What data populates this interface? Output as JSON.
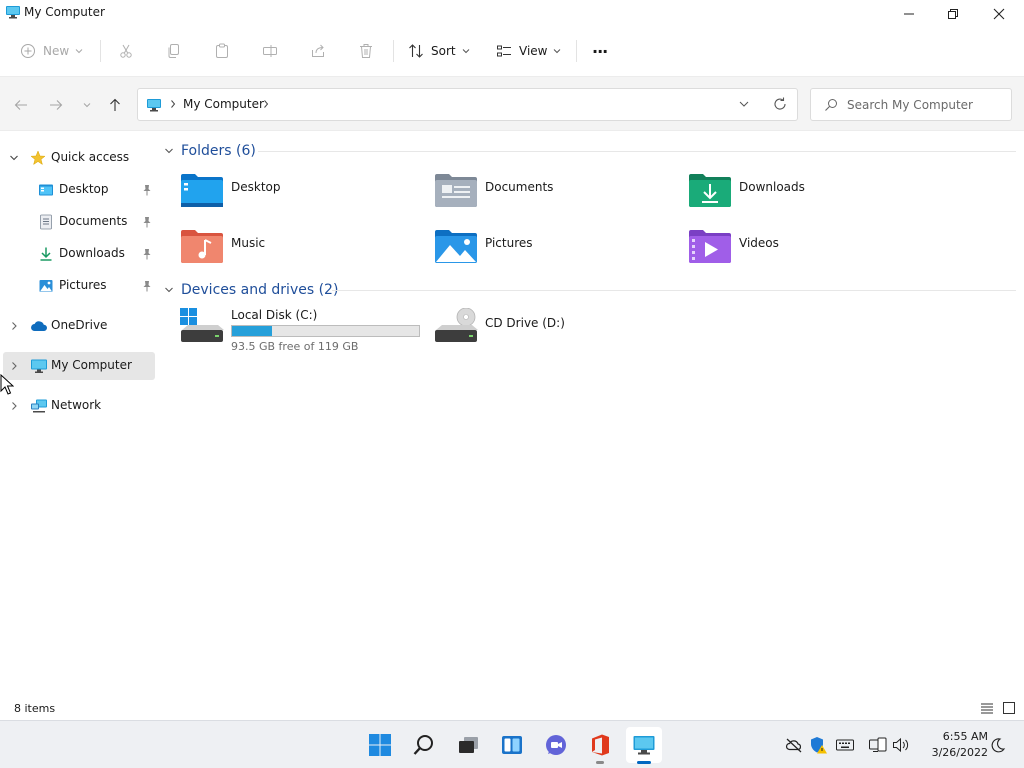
{
  "window": {
    "title": "My Computer"
  },
  "toolbar": {
    "new_label": "New",
    "sort_label": "Sort",
    "view_label": "View",
    "more_label": "···"
  },
  "nav": {
    "address_location": "My Computer",
    "search_placeholder": "Search My Computer"
  },
  "sidebar": {
    "quick_access": "Quick access",
    "items": [
      {
        "label": "Desktop",
        "icon": "desktop-icon"
      },
      {
        "label": "Documents",
        "icon": "documents-icon"
      },
      {
        "label": "Downloads",
        "icon": "downloads-icon"
      },
      {
        "label": "Pictures",
        "icon": "pictures-icon"
      }
    ],
    "onedrive": "OneDrive",
    "my_computer": "My Computer",
    "network": "Network"
  },
  "main": {
    "folders_header": "Folders (6)",
    "folders": [
      {
        "name": "Desktop",
        "icon": "desktop-folder-icon"
      },
      {
        "name": "Documents",
        "icon": "documents-folder-icon"
      },
      {
        "name": "Downloads",
        "icon": "downloads-folder-icon"
      },
      {
        "name": "Music",
        "icon": "music-folder-icon"
      },
      {
        "name": "Pictures",
        "icon": "pictures-folder-icon"
      },
      {
        "name": "Videos",
        "icon": "videos-folder-icon"
      }
    ],
    "drives_header": "Devices and drives (2)",
    "drives": [
      {
        "name": "Local Disk (C:)",
        "free_text": "93.5 GB free of 119 GB",
        "used_fraction": 0.214
      },
      {
        "name": "CD Drive (D:)"
      }
    ]
  },
  "status": {
    "items_text": "8 items"
  },
  "taskbar": {
    "time": "6:55 AM",
    "date": "3/26/2022"
  },
  "colors": {
    "accent": "#0067c0",
    "drive_bar": "#26a0da",
    "group_header": "#1f4e9a"
  }
}
